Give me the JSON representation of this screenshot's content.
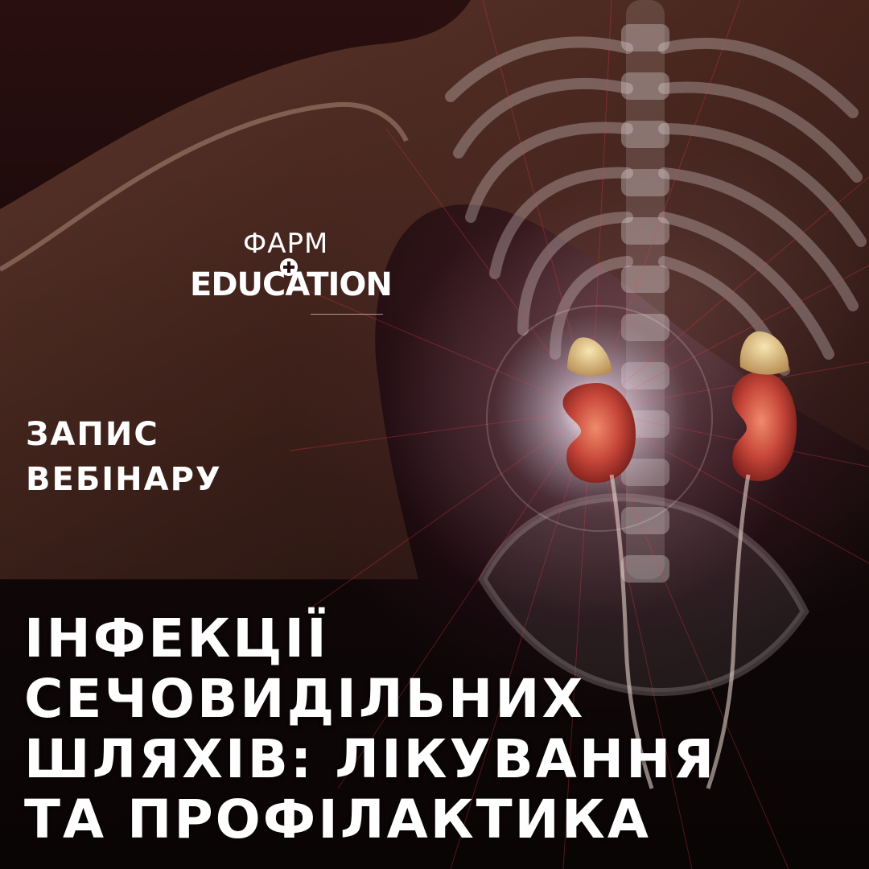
{
  "logo": {
    "line1": "ФАРМ",
    "line2": "EDUCATION",
    "icon": "plus-cross-icon"
  },
  "subtitle": {
    "line1": "ЗАПИС",
    "line2": "ВЕБІНАРУ"
  },
  "title": {
    "line1": "ІНФЕКЦІЇ",
    "line2": "СЕЧОВИДІЛЬНИХ",
    "line3": "ШЛЯХІВ: ЛІКУВАННЯ",
    "line4": "ТА ПРОФІЛАКТИКА"
  },
  "colors": {
    "background": "#170809",
    "text": "#ffffff",
    "kidney": "#c7473a",
    "glow": "#f3e6ef"
  }
}
